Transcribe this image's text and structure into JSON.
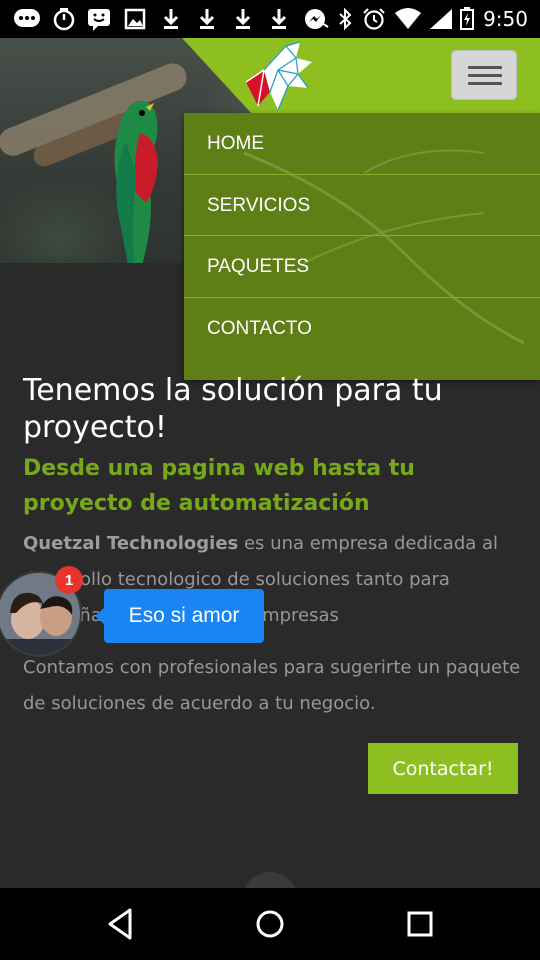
{
  "status_bar": {
    "time": "9:50",
    "icons": [
      "messaging-icon",
      "timer-icon",
      "chat-icon",
      "image-icon",
      "download-icon",
      "download-icon",
      "download-icon",
      "download-icon",
      "messenger-icon",
      "bluetooth-icon",
      "alarm-icon",
      "wifi-icon",
      "battery-icon"
    ]
  },
  "header": {
    "logo_icon": "quetzal-logo",
    "menu_icon": "hamburger-icon",
    "brand_color": "#8dbf21"
  },
  "nav": {
    "items": [
      {
        "label": "HOME"
      },
      {
        "label": "SERVICIOS"
      },
      {
        "label": "PAQUETES"
      },
      {
        "label": "CONTACTO"
      }
    ]
  },
  "main": {
    "headline": "Tenemos la solución para tu proyecto!",
    "subheadline": "Desde una pagina web hasta tu proyecto de automatización",
    "company": "Quetzal Technologies",
    "paragraph1": " es una empresa dedicada al desarrollo tecnologico de soluciones tanto para pequeñas como grandes empresas",
    "paragraph2": "Contamos con profesionales para sugerirte un paquete de soluciones de acuerdo a tu negocio.",
    "cta_label": "Contactar!"
  },
  "chat_head": {
    "badge_count": "1",
    "message": "Eso si amor"
  },
  "navbar": {
    "icons": [
      "back-icon",
      "home-icon",
      "recents-icon"
    ]
  }
}
